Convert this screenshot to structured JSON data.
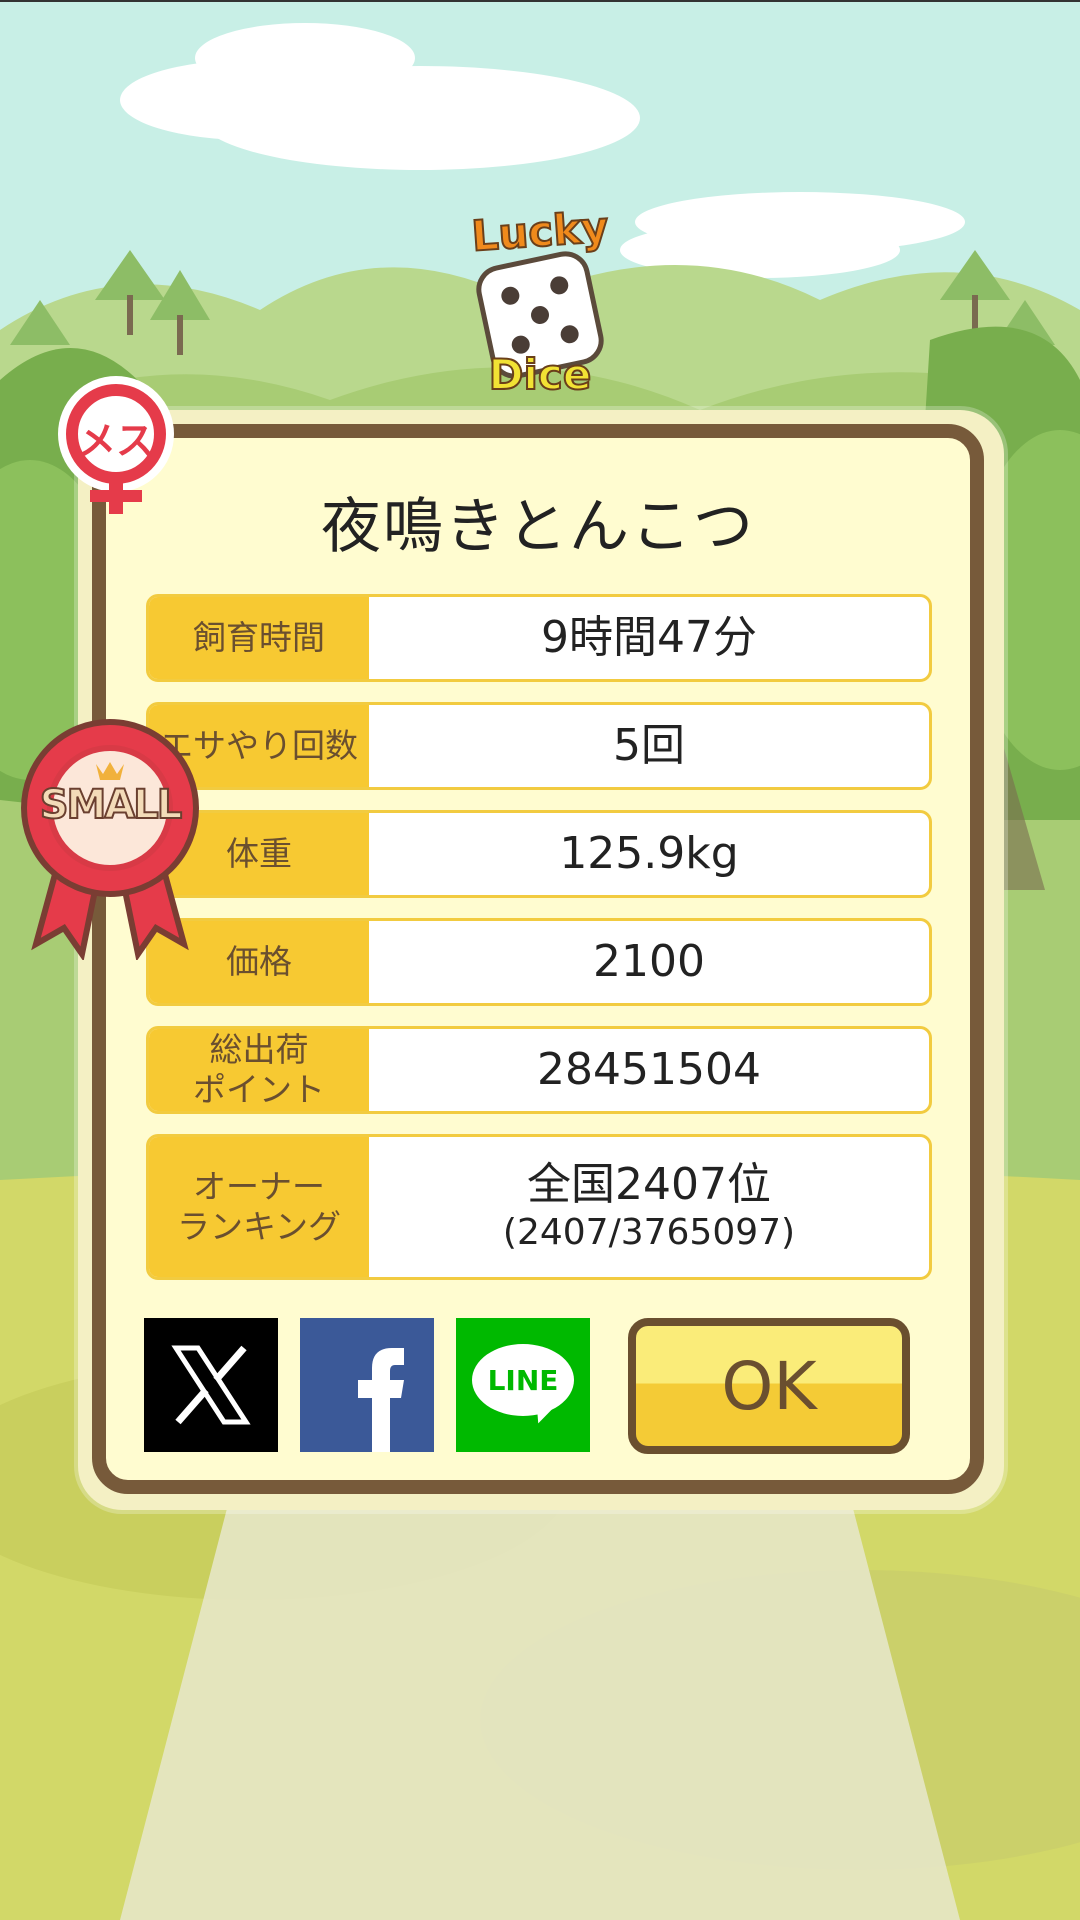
{
  "logo": {
    "line1": "Lucky",
    "line2": "Dice"
  },
  "gender_badge": {
    "label": "メス",
    "icon": "female-symbol-icon"
  },
  "size_badge": {
    "label": "SMALL",
    "icon": "ribbon-medal-icon"
  },
  "pig_name": "夜鳴きとんこつ",
  "stats": [
    {
      "label": "飼育時間",
      "value": "9時間47分"
    },
    {
      "label": "エサやり回数",
      "value": "5回"
    },
    {
      "label": "体重",
      "value": "125.9kg"
    },
    {
      "label": "価格",
      "value": "2100"
    },
    {
      "label": "総出荷\nポイント",
      "value": "28451504"
    },
    {
      "label": "オーナー\nランキング",
      "value": "全国2407位",
      "sub": "(2407/3765097)"
    }
  ],
  "share": {
    "x_icon": "x-logo-icon",
    "facebook_icon": "facebook-logo-icon",
    "line_label": "LINE"
  },
  "ok_label": "OK",
  "colors": {
    "panel_border": "#775a3a",
    "label_bg": "#f7c932",
    "panel_bg": "#fffcd0",
    "badge_red": "#e53b4a"
  }
}
